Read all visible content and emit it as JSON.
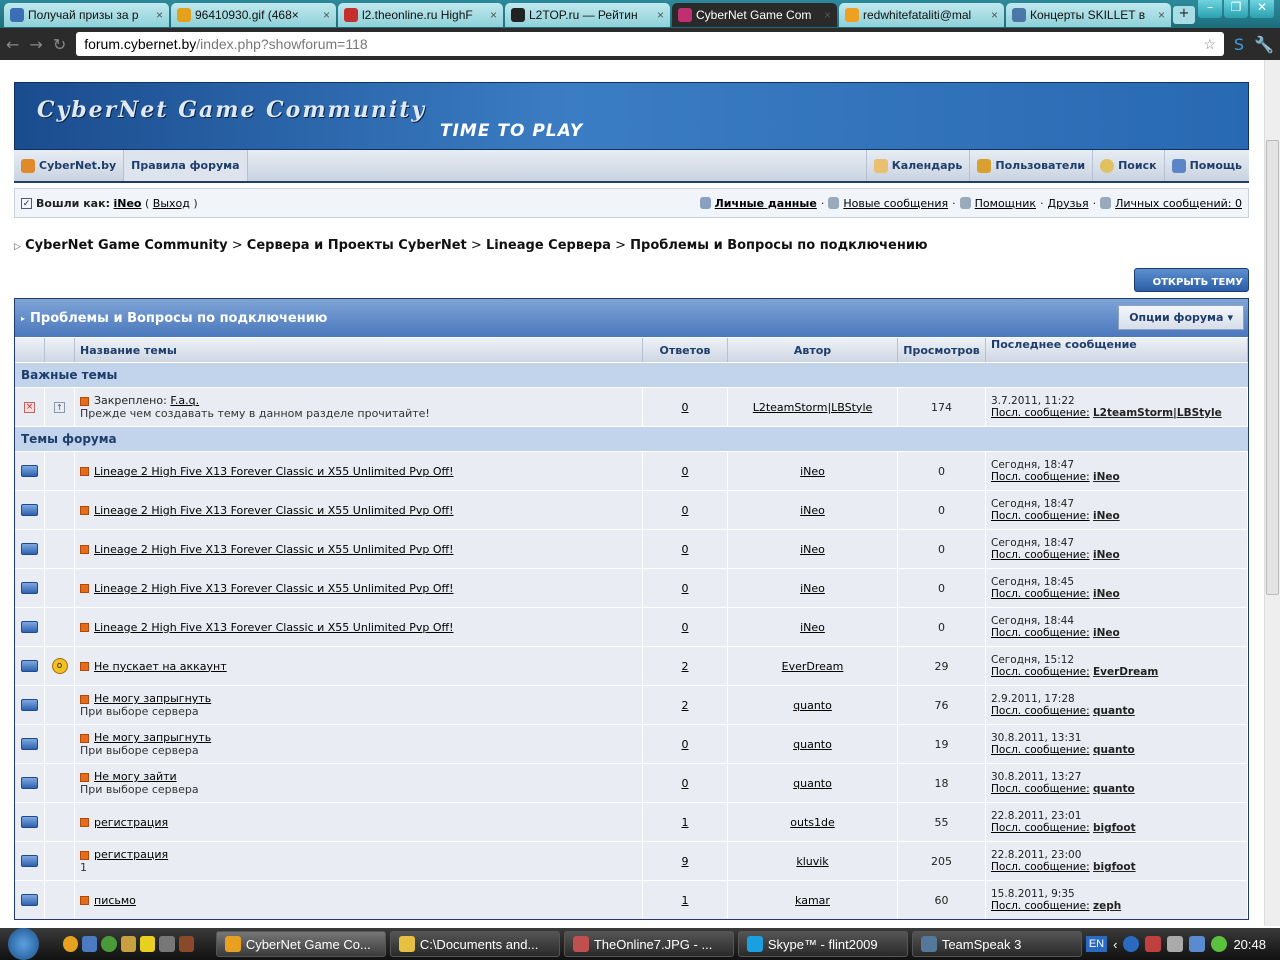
{
  "browser": {
    "tabs": [
      {
        "label": "Получай призы за р",
        "color": "#3a6fb5",
        "active": false
      },
      {
        "label": "96410930.gif (468×",
        "color": "#e3a21a",
        "active": false
      },
      {
        "label": "l2.theonline.ru HighF",
        "color": "#c4302b",
        "active": false
      },
      {
        "label": "L2TOP.ru — Рейтин",
        "color": "#222222",
        "active": false
      },
      {
        "label": "CyberNet Game Com",
        "color": "#c03070",
        "active": true
      },
      {
        "label": "redwhitefataliti@mal",
        "color": "#f0a020",
        "active": false
      },
      {
        "label": "Концерты SKILLET в",
        "color": "#4a76a8",
        "active": false
      }
    ],
    "url_host": "forum.cybernet.by",
    "url_path": "/index.php?showforum=118"
  },
  "banner": {
    "title": "CyberNet Game Community",
    "subtitle": "TIME TO PLAY"
  },
  "nav": {
    "left": [
      "CyberNet.by",
      "Правила форума"
    ],
    "right": [
      "Календарь",
      "Пользователи",
      "Поиск",
      "Помощь"
    ]
  },
  "login": {
    "label": "Вошли как:",
    "user": "iNeo",
    "logout": "Выход",
    "links": [
      "Личные данные",
      "Новые сообщения",
      "Помощник",
      "Друзья",
      "Личных сообщений: 0"
    ]
  },
  "breadcrumb": [
    "CyberNet Game Community",
    "Сервера и Проекты CyberNet",
    "Lineage Сервера",
    "Проблемы и Вопросы по подключению"
  ],
  "new_topic_button": "ОТКРЫТЬ ТЕМУ",
  "forum": {
    "title": "Проблемы и Вопросы по подключению",
    "options": "Опции форума",
    "columns": [
      "Название темы",
      "Ответов",
      "Автор",
      "Просмотров",
      "Последнее сообщение"
    ],
    "section_pinned": "Важные темы",
    "section_topics": "Темы форума",
    "last_label": "Посл. сообщение:",
    "pinned": [
      {
        "prefix": "Закреплено:",
        "title": "F.a.q.",
        "desc": "Прежде чем создавать тему в данном разделе прочитайте!",
        "replies": "0",
        "author": "L2teamStorm|LBStyle",
        "views": "174",
        "last_date": "3.7.2011, 11:22",
        "last_by": "L2teamStorm|LBStyle"
      }
    ],
    "topics": [
      {
        "title": "Lineage 2 High Five X13 Forever Classic и X55 Unlimited Pvp Off!",
        "desc": "",
        "replies": "0",
        "author": "iNeo",
        "views": "0",
        "last_date": "Сегодня, 18:47",
        "last_by": "iNeo",
        "hot": false
      },
      {
        "title": "Lineage 2 High Five X13 Forever Classic и X55 Unlimited Pvp Off!",
        "desc": "",
        "replies": "0",
        "author": "iNeo",
        "views": "0",
        "last_date": "Сегодня, 18:47",
        "last_by": "iNeo",
        "hot": false
      },
      {
        "title": "Lineage 2 High Five X13 Forever Classic и X55 Unlimited Pvp Off!",
        "desc": "",
        "replies": "0",
        "author": "iNeo",
        "views": "0",
        "last_date": "Сегодня, 18:47",
        "last_by": "iNeo",
        "hot": false
      },
      {
        "title": "Lineage 2 High Five X13 Forever Classic и X55 Unlimited Pvp Off!",
        "desc": "",
        "replies": "0",
        "author": "iNeo",
        "views": "0",
        "last_date": "Сегодня, 18:45",
        "last_by": "iNeo",
        "hot": false
      },
      {
        "title": "Lineage 2 High Five X13 Forever Classic и X55 Unlimited Pvp Off!",
        "desc": "",
        "replies": "0",
        "author": "iNeo",
        "views": "0",
        "last_date": "Сегодня, 18:44",
        "last_by": "iNeo",
        "hot": false
      },
      {
        "title": "Не пускает на аккаунт",
        "desc": "",
        "replies": "2",
        "author": "EverDream",
        "views": "29",
        "last_date": "Сегодня, 15:12",
        "last_by": "EverDream",
        "hot": true
      },
      {
        "title": "Не могу запрыгнуть",
        "desc": "При выборе сервера",
        "replies": "2",
        "author": "quanto",
        "views": "76",
        "last_date": "2.9.2011, 17:28",
        "last_by": "quanto",
        "hot": false
      },
      {
        "title": "Не могу запрыгнуть",
        "desc": "При выборе сервера",
        "replies": "0",
        "author": "quanto",
        "views": "19",
        "last_date": "30.8.2011, 13:31",
        "last_by": "quanto",
        "hot": false
      },
      {
        "title": "Не могу зайти",
        "desc": "При выборе сервера",
        "replies": "0",
        "author": "quanto",
        "views": "18",
        "last_date": "30.8.2011, 13:27",
        "last_by": "quanto",
        "hot": false
      },
      {
        "title": "регистрация",
        "desc": "",
        "replies": "1",
        "author": "outs1de",
        "views": "55",
        "last_date": "22.8.2011, 23:01",
        "last_by": "bigfoot",
        "hot": false
      },
      {
        "title": "регистрация",
        "desc": "1",
        "replies": "9",
        "author": "kluvik",
        "views": "205",
        "last_date": "22.8.2011, 23:00",
        "last_by": "bigfoot",
        "hot": false
      },
      {
        "title": "письмо",
        "desc": "",
        "replies": "1",
        "author": "kamar",
        "views": "60",
        "last_date": "15.8.2011, 9:35",
        "last_by": "zeph",
        "hot": false
      }
    ]
  },
  "taskbar": {
    "windows": [
      {
        "label": "CyberNet Game Co...",
        "color": "#e8a020",
        "active": true
      },
      {
        "label": "C:\\Documents and...",
        "color": "#e8c040",
        "active": false
      },
      {
        "label": "TheOnline7.JPG - ...",
        "color": "#c05050",
        "active": false
      },
      {
        "label": "Skype™ - flint2009",
        "color": "#1aa0e0",
        "active": false
      },
      {
        "label": "TeamSpeak 3",
        "color": "#557799",
        "active": false
      }
    ],
    "lang": "EN",
    "clock": "20:48"
  }
}
